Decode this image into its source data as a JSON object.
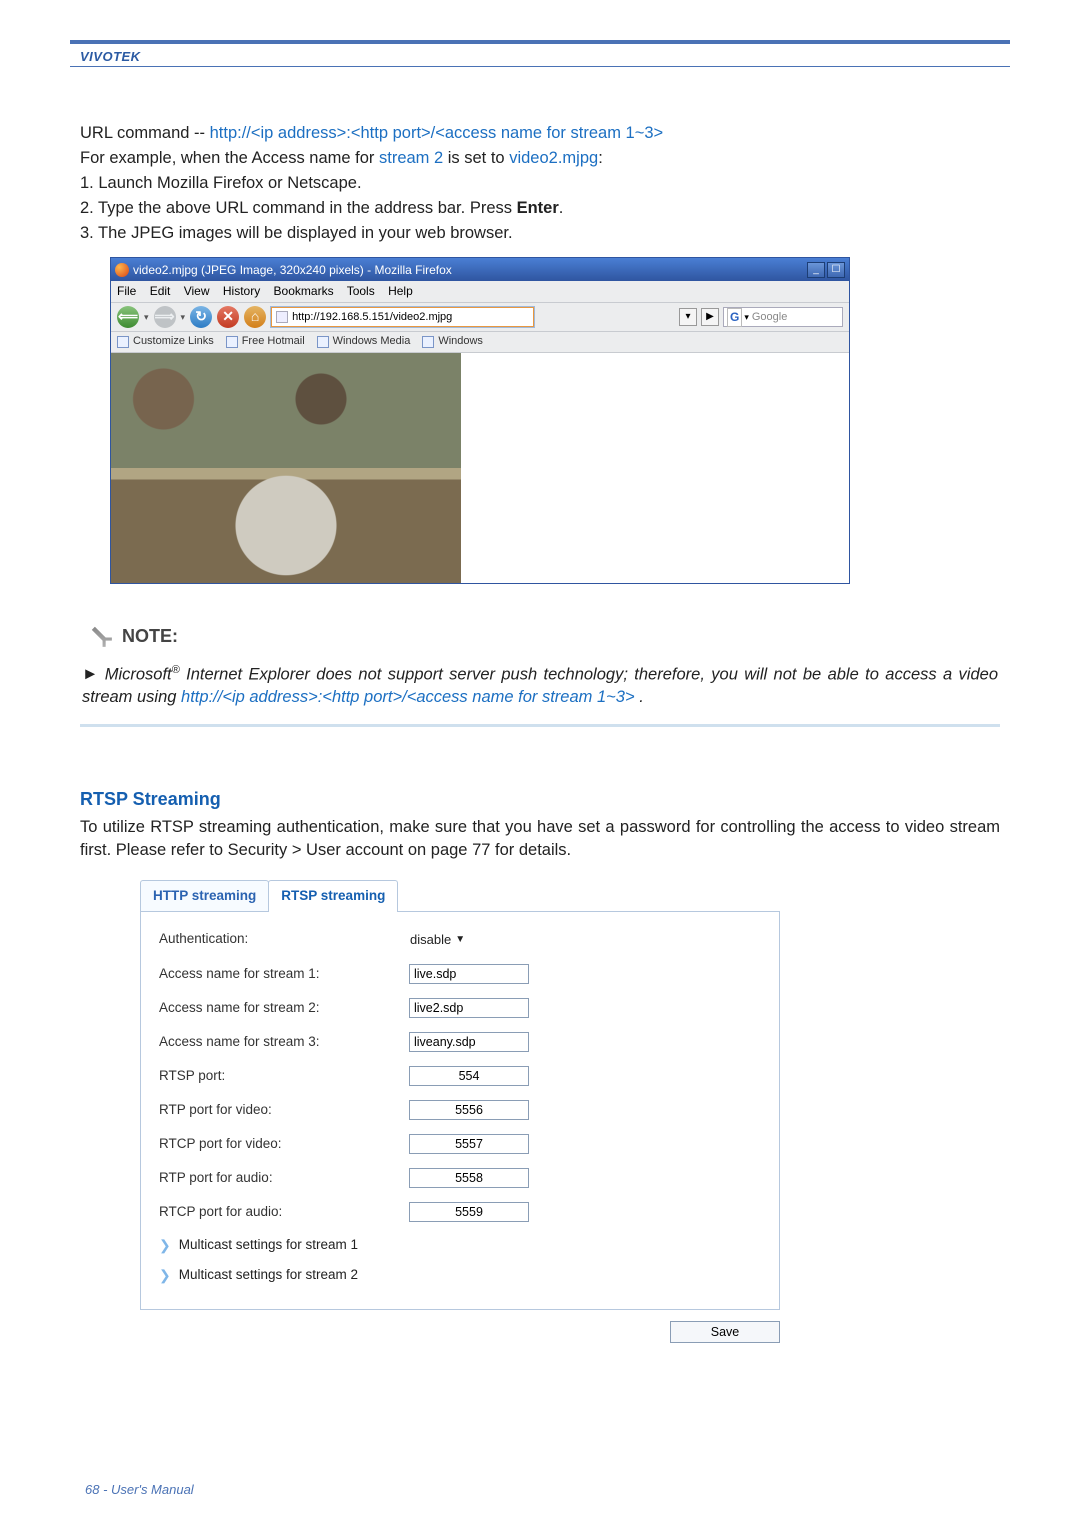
{
  "brand": "VIVOTEK",
  "intro": {
    "url_cmd_prefix": "URL command -- ",
    "url_cmd": "http://<ip address>:<http port>/<access name for stream 1~3>",
    "line2a": "For example, when the Access name for ",
    "line2b": "stream 2",
    "line2c": " is set to ",
    "line2d": "video2.mjpg",
    "line2e": ":",
    "step1": "1. Launch Mozilla Firefox or Netscape.",
    "step2a": "2. Type the above URL command in the address bar. Press ",
    "step2b": "Enter",
    "step2c": ".",
    "step3": "3. The JPEG images will be displayed in your web browser."
  },
  "firefox": {
    "title": "video2.mjpg (JPEG Image, 320x240 pixels) - Mozilla Firefox",
    "menus": [
      "File",
      "Edit",
      "View",
      "History",
      "Bookmarks",
      "Tools",
      "Help"
    ],
    "url": "http://192.168.5.151/video2.mjpg",
    "search_placeholder": "Google",
    "bookmarks": [
      "Customize Links",
      "Free Hotmail",
      "Windows Media",
      "Windows"
    ]
  },
  "note": {
    "heading": "NOTE:",
    "body_a": "Microsoft",
    "body_sup": "®",
    "body_b": " Internet Explorer does not support server push technology; therefore, you will not be able to access a video stream using ",
    "body_url": "http://<ip address>:<http port>/<access name for stream 1~3>",
    "body_c": " ."
  },
  "rtsp": {
    "heading": "RTSP Streaming",
    "para": "To utilize RTSP streaming authentication, make sure that you have set a password for controlling the access to video stream first. Please refer to Security > User account on page 77 for details.",
    "tabs": {
      "http": "HTTP streaming",
      "rtsp": "RTSP streaming"
    },
    "fields": {
      "auth_label": "Authentication:",
      "auth_value": "disable",
      "an1_label": "Access name for stream 1:",
      "an1_value": "live.sdp",
      "an2_label": "Access name for stream 2:",
      "an2_value": "live2.sdp",
      "an3_label": "Access name for stream 3:",
      "an3_value": "liveany.sdp",
      "rtsp_port_label": "RTSP port:",
      "rtsp_port_value": "554",
      "rtp_v_label": "RTP port for video:",
      "rtp_v_value": "5556",
      "rtcp_v_label": "RTCP port for video:",
      "rtcp_v_value": "5557",
      "rtp_a_label": "RTP port for audio:",
      "rtp_a_value": "5558",
      "rtcp_a_label": "RTCP port for audio:",
      "rtcp_a_value": "5559",
      "mc1": "Multicast settings for stream 1",
      "mc2": "Multicast settings for stream 2",
      "save": "Save"
    }
  },
  "footer": "68 - User's Manual"
}
